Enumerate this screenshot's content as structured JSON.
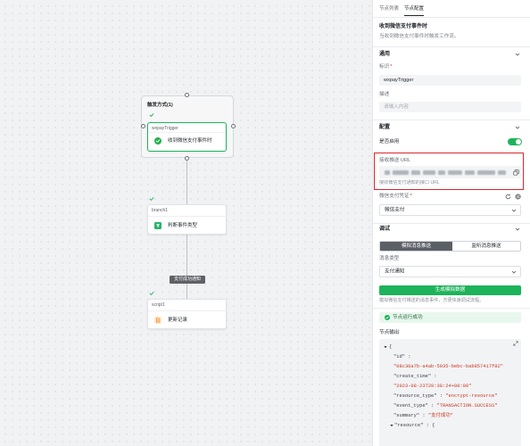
{
  "colors": {
    "accent": "#1db35a",
    "danger": "#d9272e",
    "edge_label_bg": "#5e6166"
  },
  "required_mark": "*",
  "tabs": [
    {
      "label": "节点列表",
      "active": false
    },
    {
      "label": "节点配置",
      "active": true
    }
  ],
  "node_header": {
    "title": "收到微信支付事件时",
    "description": "当收到微信支付事件时触发工作流。"
  },
  "general": {
    "title": "通用",
    "id_label": "标识",
    "id_value": "wxpayTrigger",
    "desc_label": "描述",
    "desc_placeholder": "请输入内容"
  },
  "config": {
    "title": "配置",
    "enabled_label": "是否启用",
    "enabled": true,
    "url_label": "接收推送 URL",
    "url_hint": "接收微信支付通知的接口 URL",
    "credential_label": "微信支付凭证",
    "credential_value": "微信支付",
    "icons": [
      "copy-icon",
      "refresh-icon",
      "gear-icon"
    ]
  },
  "debug": {
    "title": "调试",
    "modes": [
      "模拟消息推送",
      "监听消息推送"
    ],
    "active_mode_index": 0,
    "msg_type_label": "消息类型",
    "msg_type_value": "支付通知",
    "generate_label": "生成模拟数据",
    "generate_hint": "模拟微信支付推送的消息事件，方便快速调试流程。"
  },
  "status": {
    "text": "节点运行成功",
    "icon": "check-circle-icon"
  },
  "output": {
    "title": "节点输出",
    "lines": [
      {
        "key": "{"
      },
      {
        "key": "\"id\"",
        "sep": " :"
      },
      {
        "value": "\"08c36a7b-a4ab-5035-bebc-bab857417f82\""
      },
      {
        "key": "\"create_time\"",
        "sep": " :"
      },
      {
        "value": "\"2023-08-23T20:38:24+08:00\""
      },
      {
        "key": "\"resource_type\"",
        "sep": " : ",
        "value": "\"encrypt-resource\""
      },
      {
        "key": "\"event_type\"",
        "sep": " : ",
        "value": "\"TRANSACTION.SUCCESS\""
      },
      {
        "key": "\"summary\"",
        "sep": " : ",
        "value": "\"支付成功\""
      },
      {
        "key": "\"resource\"",
        "sep": " : {"
      }
    ]
  },
  "canvas": {
    "trigger_group": {
      "title": "触发方式(1)",
      "node_name": "wxpayTrigger",
      "node_label": "收到微信支付事件时",
      "node_icon": "wechat-pay-icon",
      "status_icon": "check-icon"
    },
    "nodes": [
      {
        "name": "branch1",
        "label": "判断事件类型",
        "icon": "filter-icon",
        "status_icon": "check-icon"
      },
      {
        "name": "script1",
        "label": "更新记录",
        "icon": "script-icon",
        "status_icon": "check-icon"
      }
    ],
    "edge_label": "支付成功通知"
  }
}
